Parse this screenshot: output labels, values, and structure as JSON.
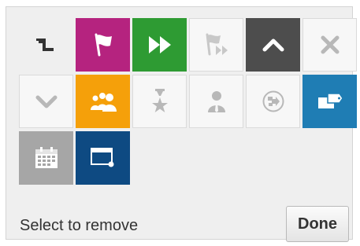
{
  "tiles": [
    {
      "icon": "step-icon",
      "bg": "transparent",
      "fg": "#333333"
    },
    {
      "icon": "flag-icon",
      "bg": "#b5237f",
      "fg": "#ffffff"
    },
    {
      "icon": "fast-forward-icon",
      "bg": "#2e9b33",
      "fg": "#ffffff"
    },
    {
      "icon": "flag-forward-icon",
      "bg": "#f7f7f7",
      "fg": "#c8c8c8"
    },
    {
      "icon": "chevron-up-icon",
      "bg": "#4d4d4d",
      "fg": "#ffffff"
    },
    {
      "icon": "close-icon",
      "bg": "#f7f7f7",
      "fg": "#b8b8b8"
    },
    {
      "icon": "chevron-down-icon",
      "bg": "#f7f7f7",
      "fg": "#b8b8b8"
    },
    {
      "icon": "group-icon",
      "bg": "#f5a00a",
      "fg": "#ffffff"
    },
    {
      "icon": "trophy-star-icon",
      "bg": "#f7f7f7",
      "fg": "#b8b8b8"
    },
    {
      "icon": "person-icon",
      "bg": "#f7f7f7",
      "fg": "#b8b8b8"
    },
    {
      "icon": "route-icon",
      "bg": "#f7f7f7",
      "fg": "#b8b8b8"
    },
    {
      "icon": "tag-card-icon",
      "bg": "#1f7db4",
      "fg": "#ffffff"
    },
    {
      "icon": "calendar-icon",
      "bg": "#a6a6a6",
      "fg": "#ffffff"
    },
    {
      "icon": "window-dot-icon",
      "bg": "#0e4a82",
      "fg": "#ffffff"
    }
  ],
  "footer": {
    "instruction": "Select to remove",
    "done_label": "Done"
  }
}
